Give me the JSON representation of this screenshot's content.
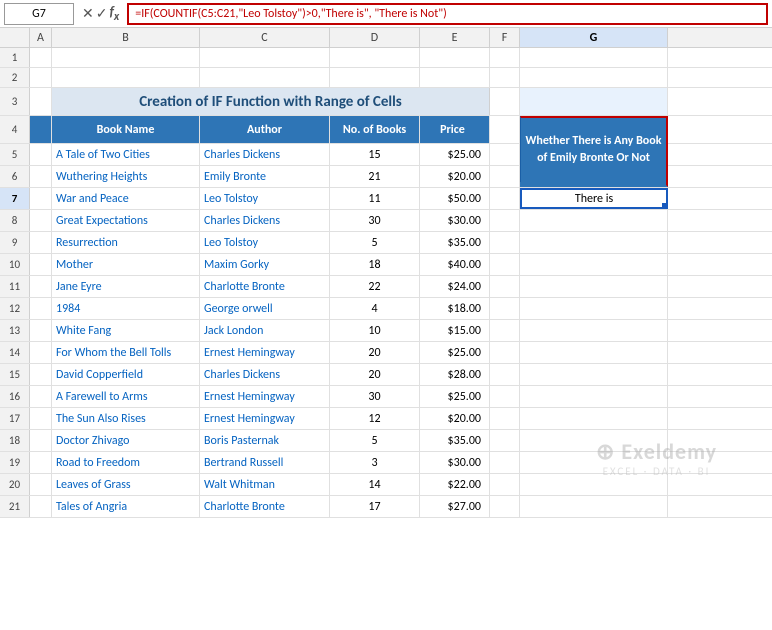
{
  "cellRef": "G7",
  "formulaBar": "=IF(COUNTIF(C5:C21,\"Leo Tolstoy\")>0,\"There is\", \"There is Not\")",
  "title": "Creation of IF Function with Range of Cells",
  "tableHeaders": {
    "bookName": "Book Name",
    "author": "Author",
    "noOfBooks": "No. of Books",
    "price": "Price"
  },
  "gBoxLabel": "Whether There is Any Book of Emily Bronte Or Not",
  "gCellValue": "There is",
  "rows": [
    {
      "book": "A Tale of Two Cities",
      "author": "Charles Dickens",
      "no": 15,
      "price": "$25.00"
    },
    {
      "book": "Wuthering Heights",
      "author": "Emily Bronte",
      "no": 21,
      "price": "$20.00"
    },
    {
      "book": "War and Peace",
      "author": "Leo Tolstoy",
      "no": 11,
      "price": "$50.00"
    },
    {
      "book": "Great Expectations",
      "author": "Charles Dickens",
      "no": 30,
      "price": "$30.00"
    },
    {
      "book": "Resurrection",
      "author": "Leo Tolstoy",
      "no": 5,
      "price": "$35.00"
    },
    {
      "book": "Mother",
      "author": "Maxim Gorky",
      "no": 18,
      "price": "$40.00"
    },
    {
      "book": "Jane Eyre",
      "author": "Charlotte Bronte",
      "no": 22,
      "price": "$24.00"
    },
    {
      "book": "1984",
      "author": "George orwell",
      "no": 4,
      "price": "$18.00"
    },
    {
      "book": "White Fang",
      "author": "Jack London",
      "no": 10,
      "price": "$15.00"
    },
    {
      "book": "For Whom the Bell Tolls",
      "author": "Ernest Hemingway",
      "no": 20,
      "price": "$25.00"
    },
    {
      "book": "David Copperfield",
      "author": "Charles Dickens",
      "no": 20,
      "price": "$28.00"
    },
    {
      "book": "A Farewell to Arms",
      "author": "Ernest Hemingway",
      "no": 30,
      "price": "$25.00"
    },
    {
      "book": "The Sun Also Rises",
      "author": "Ernest Hemingway",
      "no": 12,
      "price": "$20.00"
    },
    {
      "book": "Doctor Zhivago",
      "author": "Boris Pasternak",
      "no": 5,
      "price": "$35.00"
    },
    {
      "book": "Road to Freedom",
      "author": "Bertrand Russell",
      "no": 3,
      "price": "$30.00"
    },
    {
      "book": "Leaves of Grass",
      "author": "Walt Whitman",
      "no": 14,
      "price": "$22.00"
    },
    {
      "book": "Tales of Angria",
      "author": "Charlotte Bronte",
      "no": 17,
      "price": "$27.00"
    }
  ],
  "cols": [
    "A",
    "B",
    "C",
    "D",
    "E",
    "F",
    "G"
  ],
  "watermark": "⊕ Exeldemy\nEXCEL · DATA · BI"
}
